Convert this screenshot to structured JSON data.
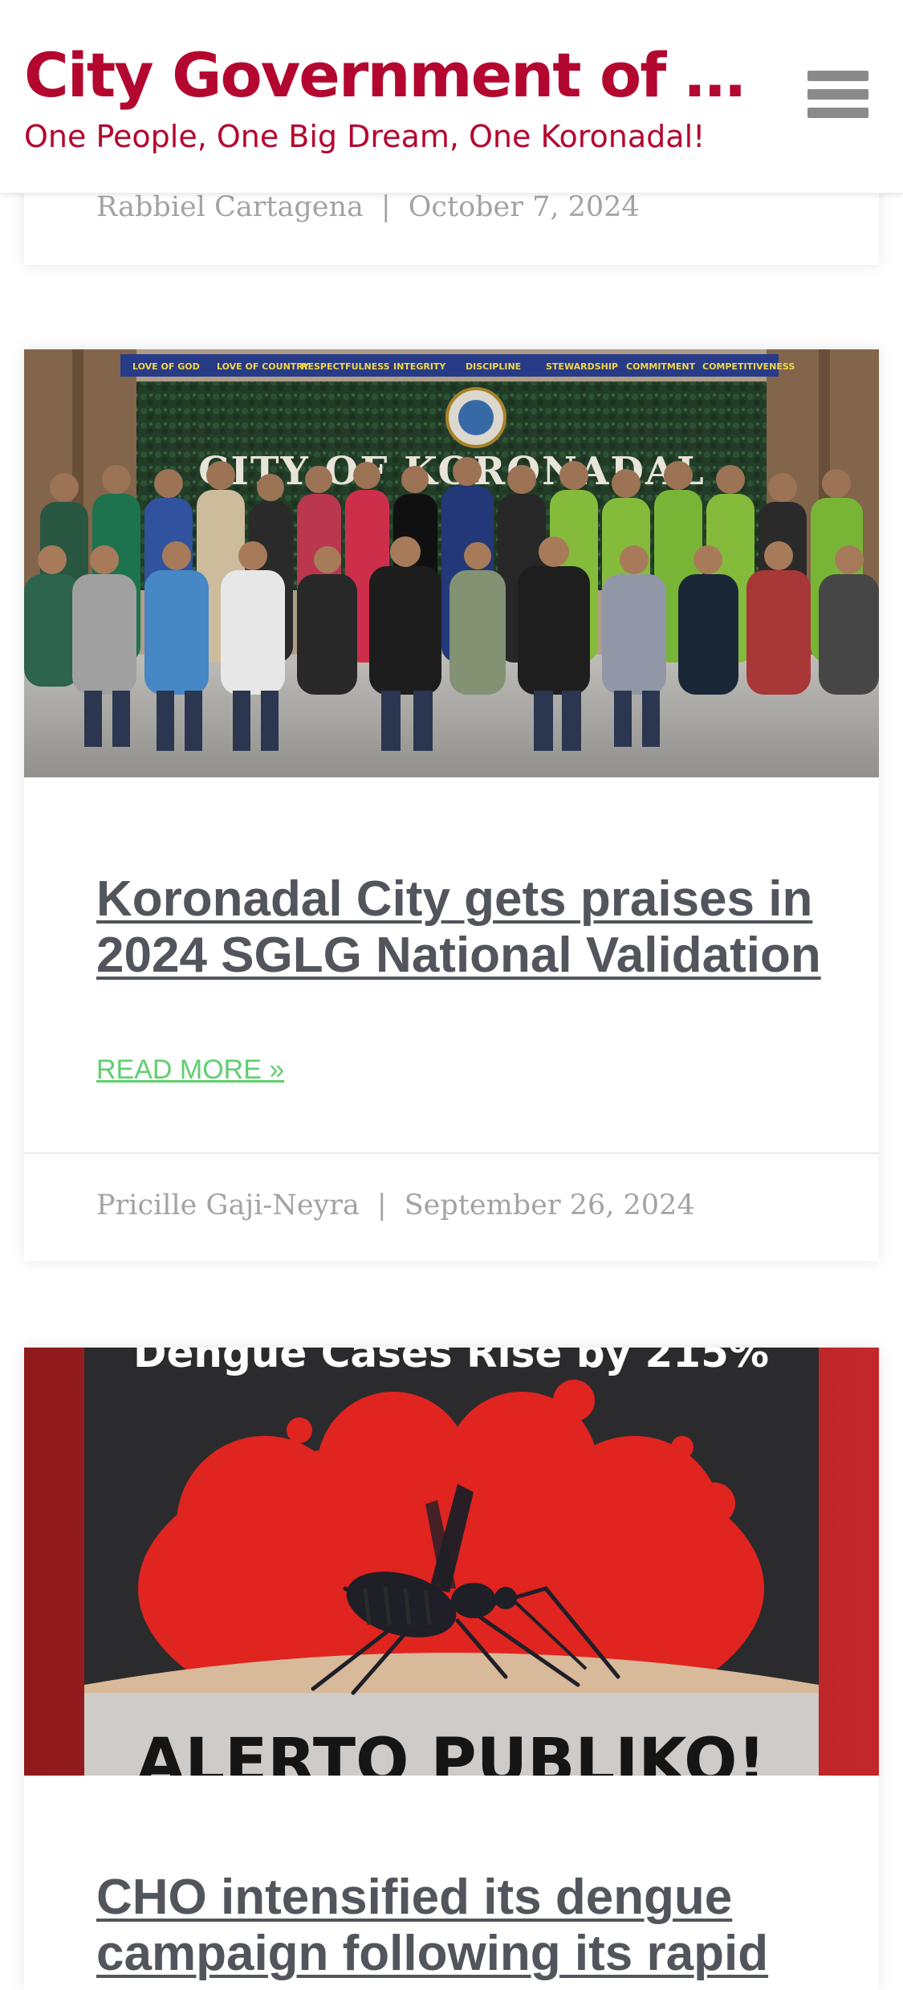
{
  "header": {
    "site_title": "City Government of K…",
    "tagline": "One People, One Big Dream, One Koronadal!",
    "menu_icon": "hamburger-menu-icon",
    "brand_color": "#b3072f"
  },
  "posts": [
    {
      "author": "Rabbiel Cartagena",
      "separator": "|",
      "date": "October 7, 2024"
    },
    {
      "banner_values": [
        "LOVE OF GOD",
        "LOVE OF COUNTRY",
        "RESPECTFULNESS",
        "INTEGRITY",
        "DISCIPLINE",
        "STEWARDSHIP",
        "COMMITMENT",
        "COMPETITIVENESS"
      ],
      "sign_text": "CITY OF KORONADAL",
      "title": "Koronadal City gets praises in 2024 SGLG National Validation",
      "read_more": "READ MORE »",
      "author": "Pricille Gaji-Neyra",
      "separator": "|",
      "date": "September 26, 2024"
    },
    {
      "image_headline": "Dengue Cases Rise by 215%",
      "image_alert": "ALERTO PUBLIKO!",
      "title": "CHO intensified its dengue campaign following its rapid"
    }
  ],
  "colors": {
    "title_text": "#52565c",
    "read_more": "#61ce70",
    "meta_text": "#a3a3a3"
  }
}
